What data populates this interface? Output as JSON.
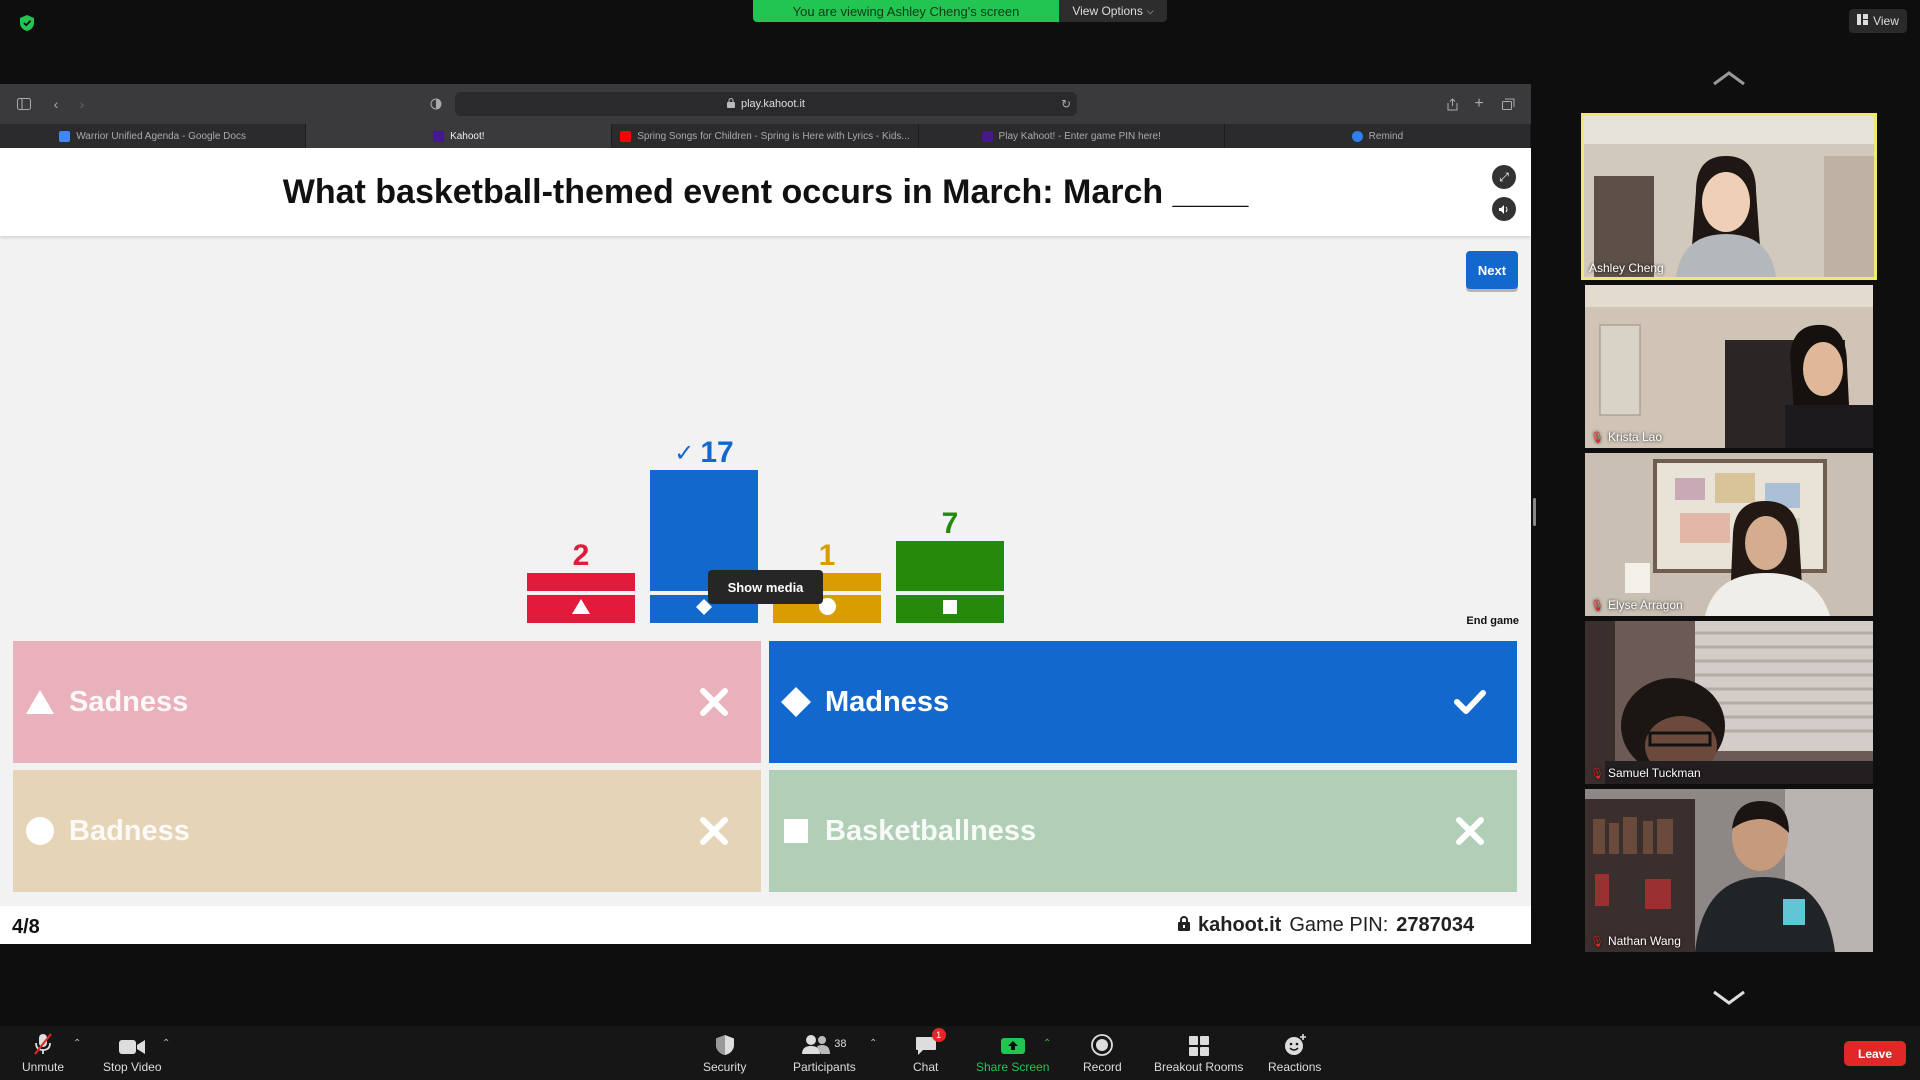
{
  "zoom": {
    "viewing_banner": "You are viewing Ashley Cheng's screen",
    "view_options": "View Options",
    "view_button": "View",
    "toolbar": {
      "unmute": "Unmute",
      "stop_video": "Stop Video",
      "security": "Security",
      "participants": "Participants",
      "participant_count": "38",
      "chat": "Chat",
      "chat_badge": "1",
      "share_screen": "Share Screen",
      "record": "Record",
      "breakout_rooms": "Breakout Rooms",
      "reactions": "Reactions",
      "leave": "Leave"
    },
    "participants": [
      {
        "name": "Ashley Cheng",
        "muted": false
      },
      {
        "name": "Krista Lao",
        "muted": true
      },
      {
        "name": "Elyse Arragon",
        "muted": true
      },
      {
        "name": "Samuel Tuckman",
        "muted": true
      },
      {
        "name": "Nathan Wang",
        "muted": true
      }
    ]
  },
  "browser": {
    "url": "play.kahoot.it",
    "tabs": [
      {
        "label": "Warrior Unified Agenda - Google Docs",
        "color": "#4285f4"
      },
      {
        "label": "Kahoot!",
        "color": "#46178f"
      },
      {
        "label": "Spring Songs for Children - Spring is Here with Lyrics - Kids...",
        "color": "#ff0000"
      },
      {
        "label": "Play Kahoot! - Enter game PIN here!",
        "color": "#46178f"
      },
      {
        "label": "Remind",
        "color": "#2f80ed"
      }
    ]
  },
  "kahoot": {
    "question": "What basketball-themed event occurs in March: March ____",
    "next": "Next",
    "show_media": "Show media",
    "end_game": "End game",
    "results": [
      {
        "count": "2",
        "color": "#e21b3c",
        "shape": "triangle",
        "correct": false
      },
      {
        "count": "17",
        "color": "#1368ce",
        "shape": "diamond",
        "correct": true
      },
      {
        "count": "1",
        "color": "#d89e00",
        "shape": "circle",
        "correct": false
      },
      {
        "count": "7",
        "color": "#26890c",
        "shape": "square",
        "correct": false
      }
    ],
    "answers": [
      {
        "label": "Sadness",
        "shape": "triangle",
        "correct": false,
        "bg": "#e8b1bb"
      },
      {
        "label": "Madness",
        "shape": "diamond",
        "correct": true,
        "bg": "#1368ce"
      },
      {
        "label": "Badness",
        "shape": "circle",
        "correct": false,
        "bg": "#e6d4b6"
      },
      {
        "label": "Basketballness",
        "shape": "square",
        "correct": false,
        "bg": "#b0cfb6"
      }
    ],
    "progress": "4/8",
    "site": "kahoot.it",
    "pin_label": "Game PIN:",
    "pin": "2787034"
  }
}
